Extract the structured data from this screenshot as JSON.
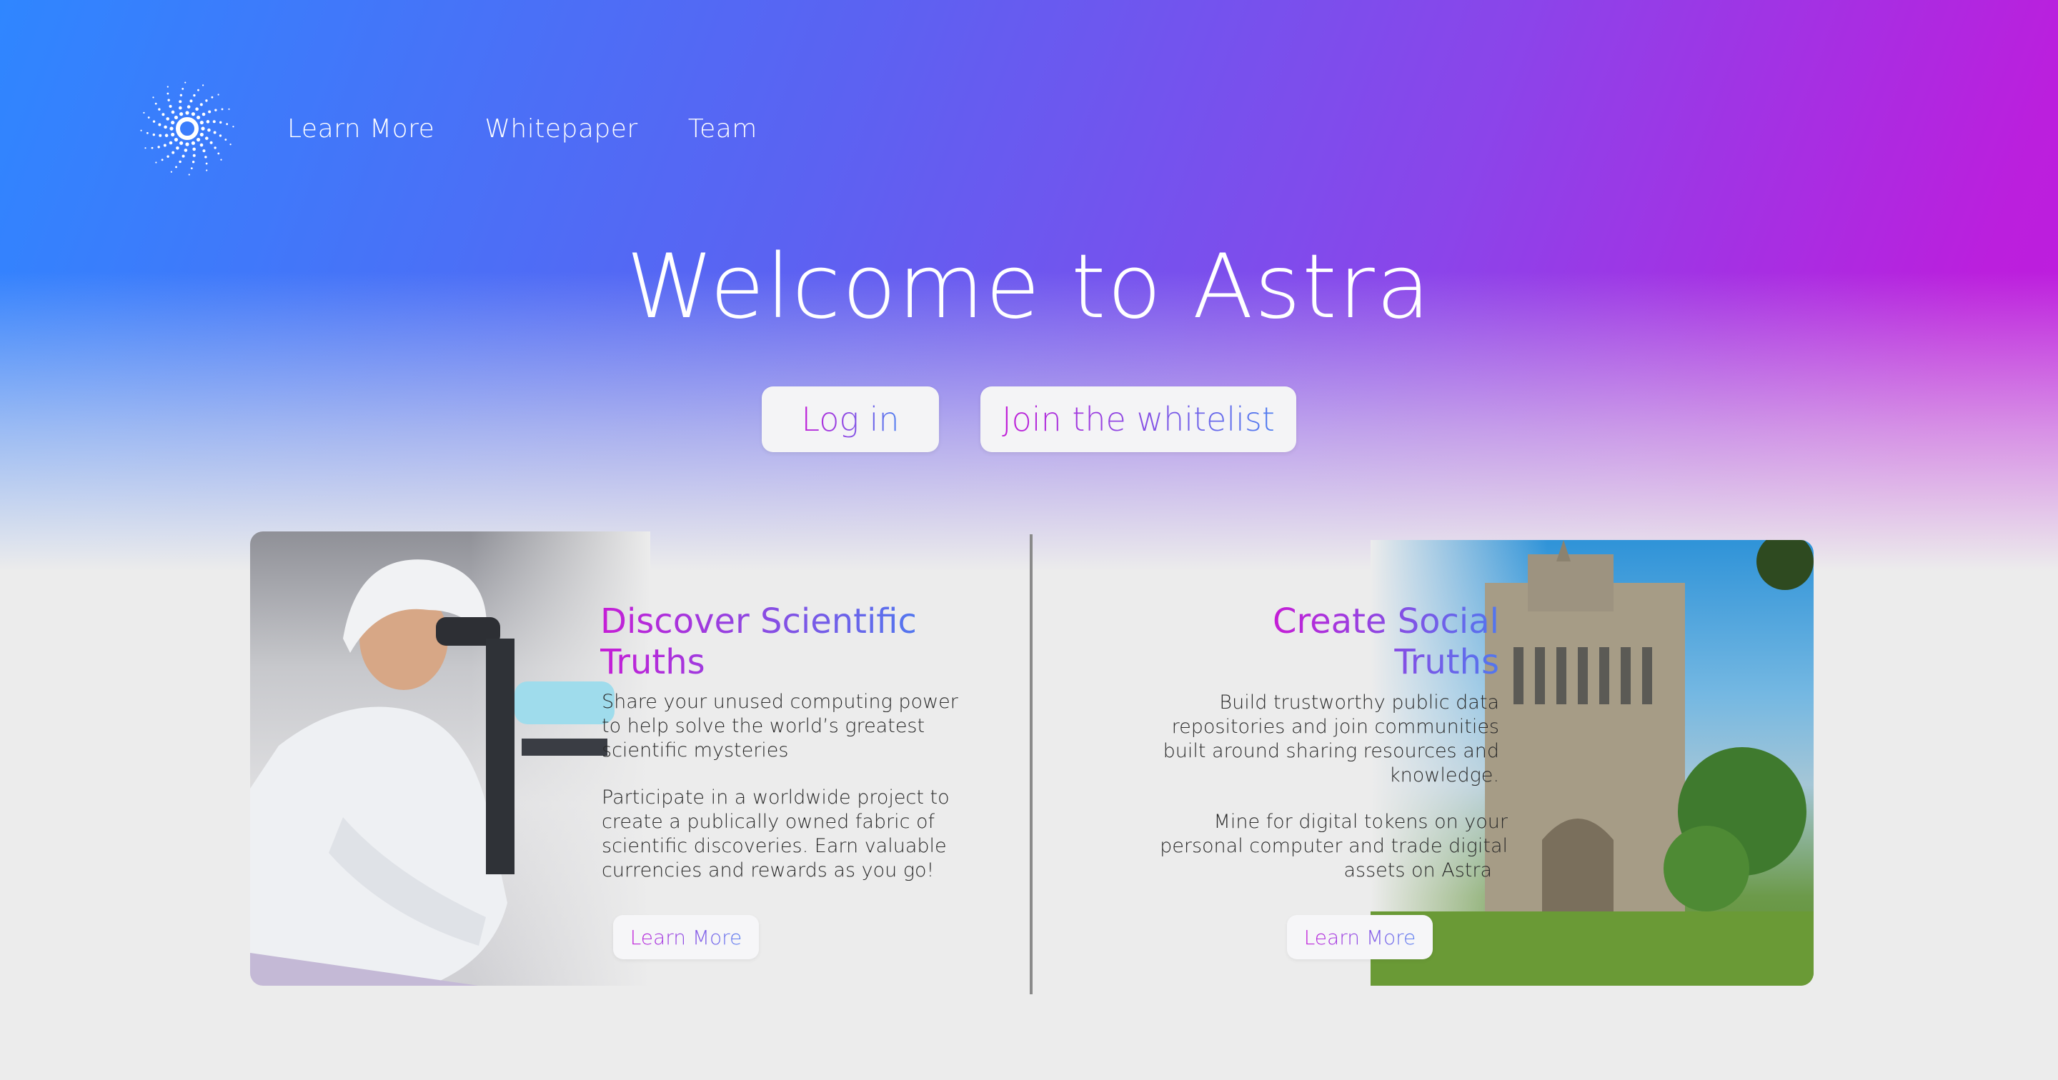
{
  "nav": {
    "logo_icon": "sunburst-logo-icon",
    "links": [
      "Learn More",
      "Whitepaper",
      "Team"
    ]
  },
  "hero": {
    "title": "Welcome to Astra",
    "login_label": "Log in",
    "whitelist_label": "Join the whitelist"
  },
  "cards": {
    "science": {
      "title_line1": "Discover Scientific",
      "title_line2": "Truths",
      "para1": [
        "Share your unused computing power",
        "to help solve the world’s greatest",
        "scientific mysteries"
      ],
      "para2": [
        "Participate in a worldwide project to",
        "create a publically owned fabric of",
        "scientific discoveries. Earn valuable",
        "currencies and rewards as you go!"
      ],
      "button_label": "Learn More",
      "image": "scientist-with-microscope-photo"
    },
    "social": {
      "title_line1": "Create Social",
      "title_line2": "Truths",
      "para1": [
        "Build trustworthy public data",
        "repositories and join communities",
        "built around sharing resources and",
        "knowledge."
      ],
      "para2": [
        "Mine for digital tokens on your",
        "personal computer and trade digital",
        "assets on Astra"
      ],
      "button_label": "Learn More",
      "image": "gothic-library-building-photo"
    }
  },
  "colors": {
    "gradient_start": "#2f86ff",
    "gradient_mid": "#8a45ea",
    "gradient_end": "#c51adf",
    "background": "#ececec",
    "divider": "#8a8a8a"
  }
}
